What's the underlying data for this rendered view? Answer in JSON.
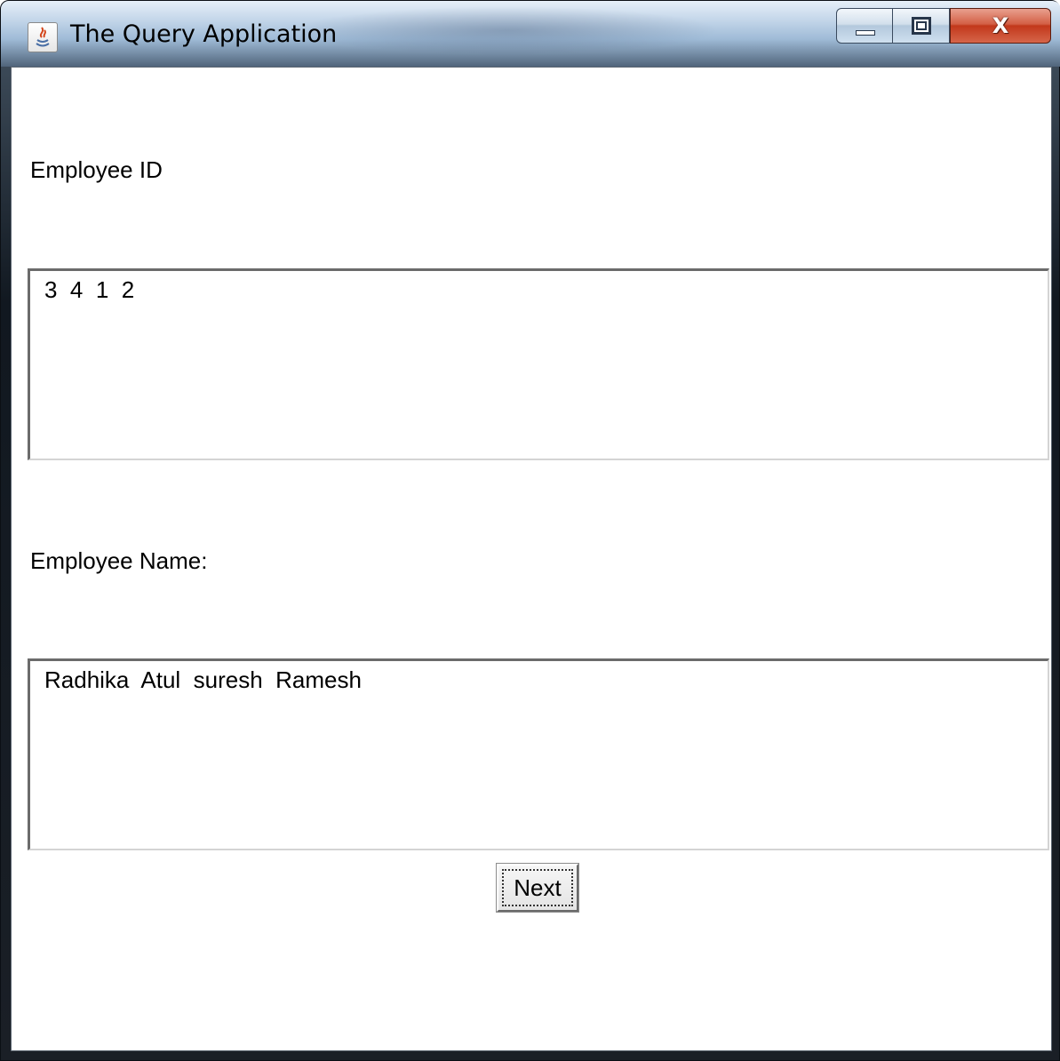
{
  "window": {
    "title": "The Query Application",
    "app_icon": "java-coffee-icon",
    "controls": {
      "minimize_icon": "minimize-icon",
      "maximize_icon": "maximize-icon",
      "close_glyph": "X"
    }
  },
  "form": {
    "employee_id_label": "Employee ID",
    "employee_id_values": "3  4  1  2",
    "employee_name_label": "Employee Name:",
    "employee_name_values": "Radhika  Atul  suresh  Ramesh",
    "next_button_label": "Next"
  },
  "colors": {
    "close_button": "#c2381b",
    "content_background": "#ffffff"
  }
}
